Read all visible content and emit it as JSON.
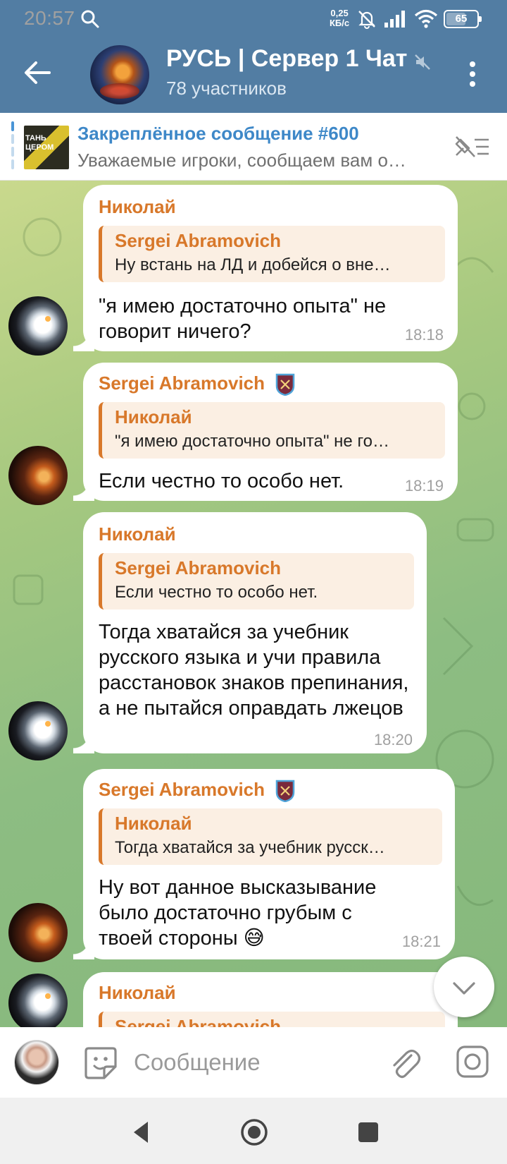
{
  "status_bar": {
    "time": "20:57",
    "net_speed_value": "0,25",
    "net_speed_unit": "КБ/с",
    "battery": "65",
    "battery_fraction": 0.65
  },
  "header": {
    "title": "РУСЬ | Сервер 1 Чат",
    "subtitle": "78 участников",
    "background": "#527da3"
  },
  "pinned": {
    "title": "Закреплённое сообщение #600",
    "text": "Уважаемые игроки, сообщаем вам о…",
    "thumb_text": "ТАНЬ ЦЕРОМ"
  },
  "messages": [
    {
      "sender": "Николай",
      "reply_name": "Sergei Abramovich",
      "reply_text": "Ну встань на ЛД и добейся о вне…",
      "text": "\"я имею достаточно опыта\" не говорит ничего?",
      "time": "18:18"
    },
    {
      "sender": "Sergei Abramovich",
      "reply_name": "Николай",
      "reply_text": "\"я имею достаточно опыта\" не го…",
      "text": "Если честно то особо нет.",
      "time": "18:19"
    },
    {
      "sender": "Николай",
      "reply_name": "Sergei Abramovich",
      "reply_text": "Если честно то особо нет.",
      "text": "Тогда хватайся за учебник русского языка и учи правила расстановок знаков препинания, а не пытайся оправдать лжецов",
      "time": "18:20"
    },
    {
      "sender": "Sergei Abramovich",
      "reply_name": "Николай",
      "reply_text": "Тогда хватайся за учебник русск…",
      "text": "Ну вот данное высказывание было достаточно грубым с твоей стороны",
      "emoji": "😅",
      "time": "18:21"
    },
    {
      "sender": "Николай",
      "reply_name": "Sergei Abramovich"
    }
  ],
  "input": {
    "placeholder": "Сообщение"
  },
  "colors": {
    "accent_blue": "#3e88c8",
    "sender_orange": "#d8782a"
  },
  "icons": [
    "back-arrow-icon",
    "mute-icon",
    "more-vert-icon",
    "unpin-icon",
    "chevron-down-icon",
    "sticker-icon",
    "paperclip-icon",
    "camera-icon",
    "nav-back-icon",
    "nav-home-icon",
    "nav-recents-icon"
  ]
}
